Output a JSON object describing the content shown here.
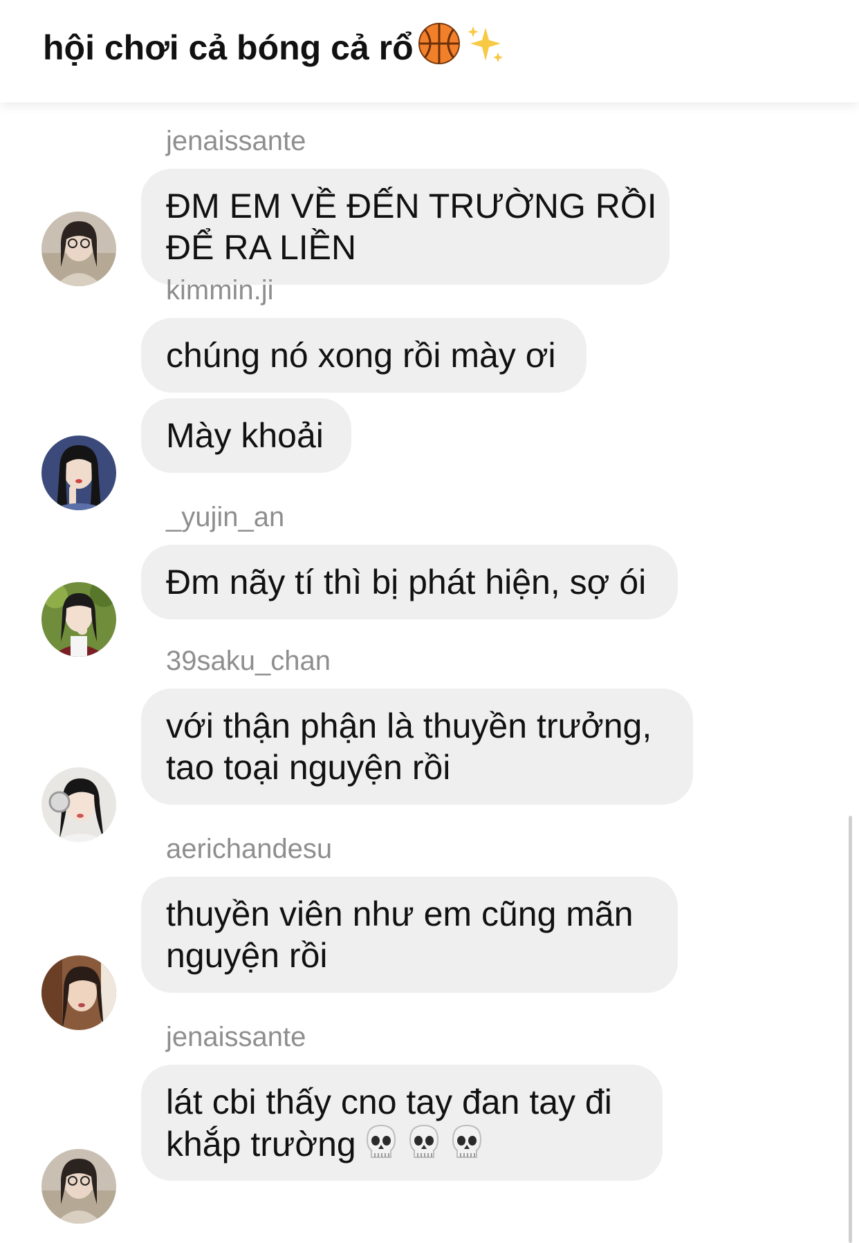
{
  "header": {
    "title": "hội chơi cả bóng cả rổ",
    "emojis": [
      "basketball-icon",
      "sparkles-icon"
    ]
  },
  "messages": [
    {
      "sender": "jenaissante",
      "lines": [
        "ĐM EM VỀ ĐẾN TRƯỜNG RỒI",
        "ĐỂ RA LIỀN"
      ]
    },
    {
      "sender": "kimmin.ji",
      "lines": [
        "chúng nó xong rồi mày ơi"
      ],
      "lines2": [
        "Mày khoải"
      ]
    },
    {
      "sender": "_yujin_an",
      "lines": [
        "Đm nãy tí thì bị phát hiện, sợ ói"
      ]
    },
    {
      "sender": "39saku_chan",
      "lines": [
        "với thận phận là thuyền trưởng,",
        "tao toại nguyện rồi"
      ]
    },
    {
      "sender": "aerichandesu",
      "lines": [
        "thuyền viên như em cũng mãn",
        "nguyện rồi"
      ]
    },
    {
      "sender": "jenaissante",
      "lines": [
        "lát cbi thấy cno tay đan tay đi",
        "khắp trường"
      ],
      "trailing_emojis": [
        "skull-icon",
        "skull-icon",
        "skull-icon"
      ]
    }
  ],
  "colors": {
    "bubble": "#efeff0",
    "sender": "#8e8e8e",
    "text": "#111111",
    "background": "#ffffff"
  }
}
